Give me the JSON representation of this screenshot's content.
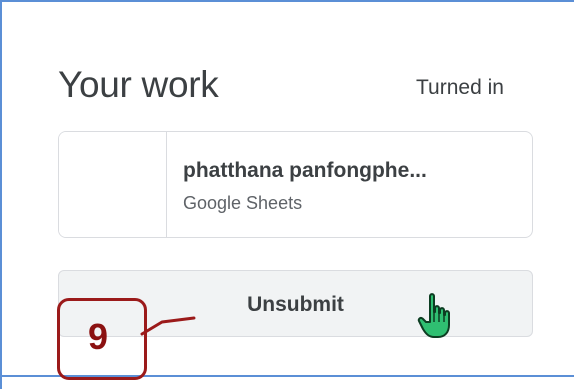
{
  "your_work": {
    "heading": "Your work",
    "status": "Turned in"
  },
  "attachment": {
    "title": "phatthana panfongphe...",
    "type": "Google Sheets"
  },
  "actions": {
    "unsubmit_label": "Unsubmit"
  },
  "annotation": {
    "step_number": "9"
  },
  "icons": {
    "cursor": "hand-pointer-icon"
  },
  "colors": {
    "frame_border": "#5b8fd6",
    "annotation": "#9b1a1a",
    "cursor_fill": "#2fbf71"
  }
}
